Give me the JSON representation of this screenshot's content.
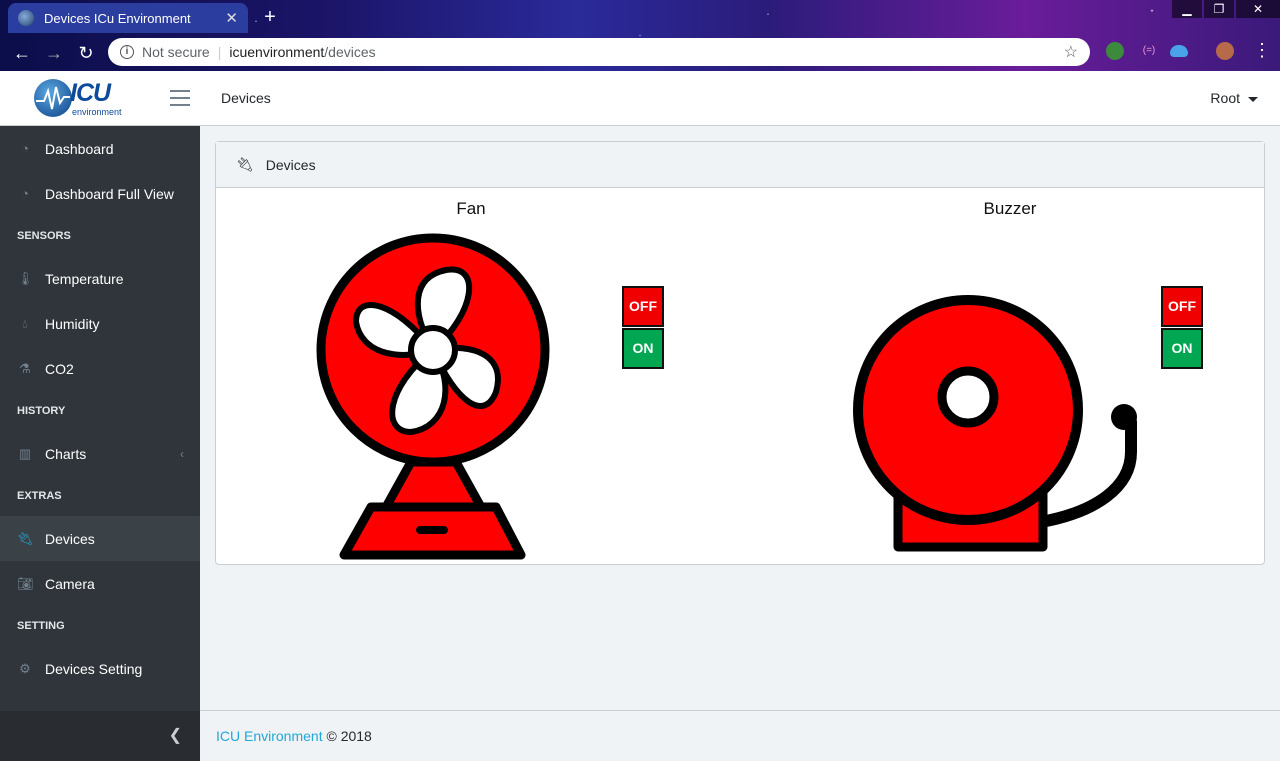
{
  "browser": {
    "tab_title": "Devices ICu Environment",
    "tab_close": "✕",
    "new_tab": "+",
    "not_secure": "Not secure",
    "url_host": "icuenvironment",
    "url_path": "/devices",
    "win_min": "▁",
    "win_restore": "❐",
    "win_close": "✕"
  },
  "header": {
    "logo_text": "ICU",
    "logo_sub": "environment",
    "breadcrumb": "Devices",
    "user": "Root"
  },
  "sidebar": {
    "items": [
      {
        "label": "Dashboard",
        "icon": "speedometer-icon"
      },
      {
        "label": "Dashboard Full View",
        "icon": "speedometer-icon"
      }
    ],
    "sensors_title": "SENSORS",
    "sensors": [
      {
        "label": "Temperature",
        "icon": "thermometer-icon"
      },
      {
        "label": "Humidity",
        "icon": "drop-icon"
      },
      {
        "label": "CO2",
        "icon": "flask-icon"
      }
    ],
    "history_title": "HISTORY",
    "history": [
      {
        "label": "Charts",
        "icon": "bar-chart-icon"
      }
    ],
    "extras_title": "EXTRAS",
    "extras": [
      {
        "label": "Devices",
        "icon": "plug-icon",
        "active": true
      },
      {
        "label": "Camera",
        "icon": "camera-icon"
      }
    ],
    "setting_title": "SETTING",
    "setting": [
      {
        "label": "Devices Setting",
        "icon": "gear-icon"
      }
    ]
  },
  "card": {
    "title": "Devices",
    "devices": [
      {
        "name": "Fan",
        "off_label": "OFF",
        "on_label": "ON",
        "image": "fan-icon"
      },
      {
        "name": "Buzzer",
        "off_label": "OFF",
        "on_label": "ON",
        "image": "bell-icon"
      }
    ]
  },
  "footer": {
    "link": "ICU Environment",
    "copyright": "© 2018"
  },
  "colors": {
    "sidebar_bg": "#2f353a",
    "accent": "#20a8d8",
    "device_red": "#ff0000",
    "off_red": "#f00000",
    "on_green": "#00a651"
  }
}
